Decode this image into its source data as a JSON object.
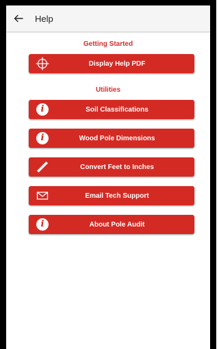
{
  "appbar": {
    "title": "Help",
    "back_icon": "arrow-left-icon"
  },
  "sections": {
    "getting_started": "Getting Started",
    "utilities": "Utilities"
  },
  "buttons": {
    "display_help_pdf": {
      "label": "Display Help PDF",
      "icon": "crosshair-icon"
    },
    "soil_classifications": {
      "label": "Soil Classifications",
      "icon": "info-icon",
      "icon_glyph": "i"
    },
    "wood_pole_dimensions": {
      "label": "Wood Pole Dimensions",
      "icon": "info-icon",
      "icon_glyph": "i"
    },
    "convert_feet_to_inches": {
      "label": "Convert Feet to Inches",
      "icon": "ruler-icon"
    },
    "email_tech_support": {
      "label": "Email Tech Support",
      "icon": "envelope-icon"
    },
    "about_pole_audit": {
      "label": "About Pole Audit",
      "icon": "info-icon",
      "icon_glyph": "i"
    }
  },
  "colors": {
    "accent": "#d42a24",
    "section_text": "#d32f2f",
    "appbar_bg": "#f5f5f5",
    "frame": "#000000"
  }
}
